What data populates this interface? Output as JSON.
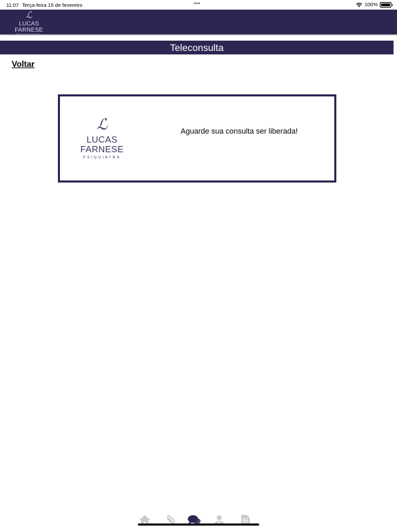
{
  "status_bar": {
    "time": "11:07",
    "date": "Terça-feira 15 de fevereiro",
    "dots": "•••",
    "battery_percent": "100%",
    "battery_level": 1.0
  },
  "header": {
    "logo_monogram": "ℒ",
    "logo_name": "LUCAS FARNESE",
    "logo_subtitle": "PSIQUIATRA"
  },
  "page": {
    "title": "Teleconsulta",
    "back_label": "Voltar"
  },
  "card": {
    "logo_monogram": "ℒ",
    "logo_name": "LUCAS FARNESE",
    "logo_subtitle": "PSIQUIATRA",
    "message": "Aguarde sua consulta ser liberada!"
  },
  "bottom_nav": {
    "items": [
      {
        "icon": "home-icon",
        "active": false
      },
      {
        "icon": "paperclip-icon",
        "active": false
      },
      {
        "icon": "chat-bubbles-icon",
        "active": true
      },
      {
        "icon": "doctor-icon",
        "active": false
      },
      {
        "icon": "document-icon",
        "active": false
      }
    ]
  },
  "colors": {
    "brand": "#2c2752",
    "nav_inactive": "#c8c8c8",
    "nav_active": "#2c2752"
  }
}
